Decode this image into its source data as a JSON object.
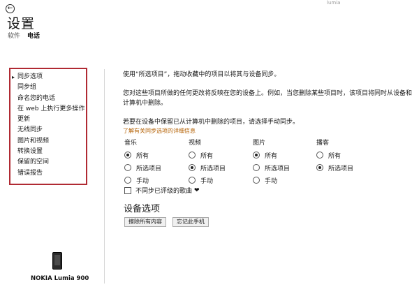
{
  "header": {
    "title": "设置",
    "tabs": [
      {
        "label": "软件",
        "active": false
      },
      {
        "label": "电话",
        "active": true
      }
    ],
    "back_icon": "arrow-left-circle-icon",
    "corner_text": "lumia"
  },
  "sidebar": {
    "items": [
      {
        "label": "同步选项",
        "active": true
      },
      {
        "label": "同步组"
      },
      {
        "label": "命名您的电话"
      },
      {
        "label": "在 web 上执行更多操作"
      },
      {
        "label": "更新"
      },
      {
        "label": "无线同步"
      },
      {
        "label": "图片和视频"
      },
      {
        "label": "转换设置"
      },
      {
        "label": "保留的空间"
      },
      {
        "label": "错误报告"
      }
    ],
    "border_color": "#b02a33"
  },
  "device": {
    "name": "NOKIA Lumia 900",
    "icon": "phone-icon"
  },
  "content": {
    "intro": "使用“所选项目”，拖动收藏中的项目以将其与设备同步。",
    "warning": "您对这些项目所做的任何更改将反映在您的设备上。例如，当您删除某些项目时，该项目将同时从设备和计算机中删除。",
    "keep_text": "若要在设备中保留已从计算机中删除的项目，请选择手动同步。",
    "learn_more": "了解有关同步选项的详细信息",
    "link_color": "#b35f00",
    "categories": [
      {
        "name": "音乐",
        "options": [
          "所有",
          "所选项目",
          "手动"
        ],
        "selected": 0
      },
      {
        "name": "视频",
        "options": [
          "所有",
          "所选项目",
          "手动"
        ],
        "selected": 1
      },
      {
        "name": "图片",
        "options": [
          "所有",
          "所选项目",
          "手动"
        ],
        "selected": 0
      },
      {
        "name": "播客",
        "options": [
          "所有",
          "所选项目"
        ],
        "selected": 1
      }
    ],
    "unrated_checkbox": {
      "label": "不同步已评级的歌曲",
      "checked": false,
      "icon": "broken-heart-icon"
    },
    "device_options_title": "设备选项",
    "buttons": {
      "erase": "擦除所有内容",
      "forget": "忘记此手机"
    }
  }
}
